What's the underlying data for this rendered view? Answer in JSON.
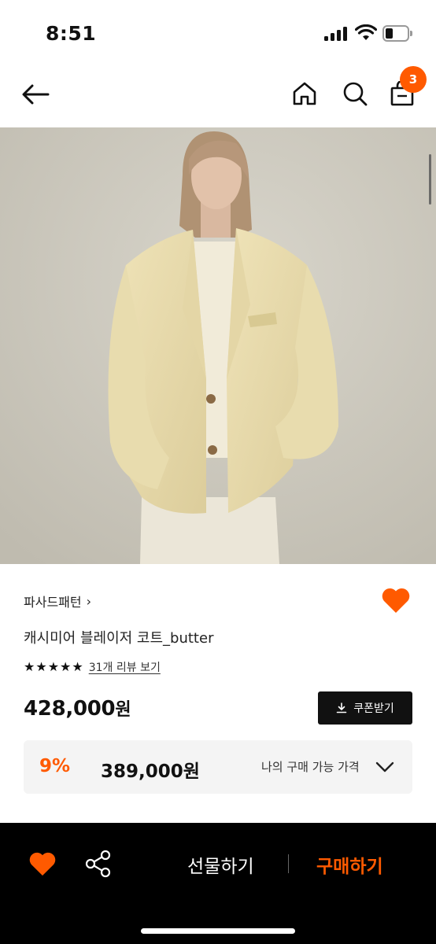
{
  "status_bar": {
    "time": "8:51"
  },
  "header": {
    "cart_count": "3"
  },
  "product": {
    "brand": "파사드패턴",
    "brand_chevron": "›",
    "title": "캐시미어 블레이저 코트_butter",
    "rating_stars": 5,
    "review_link": "31개 리뷰 보기",
    "price": "428,000",
    "price_unit": "원",
    "coupon_label": "쿠폰받기",
    "discount": {
      "rate": "9%",
      "price": "389,000원",
      "label": "나의 구매 가능 가격"
    }
  },
  "bottom_bar": {
    "gift_label": "선물하기",
    "buy_label": "구매하기"
  },
  "colors": {
    "accent": "#ff5a00",
    "dark": "#111111",
    "discount_bg": "#f4f4f4"
  },
  "icons": [
    "back-arrow-icon",
    "home-icon",
    "search-icon",
    "shopping-bag-icon",
    "heart-icon",
    "download-icon",
    "chevron-down-icon",
    "share-icon",
    "star-icon"
  ]
}
